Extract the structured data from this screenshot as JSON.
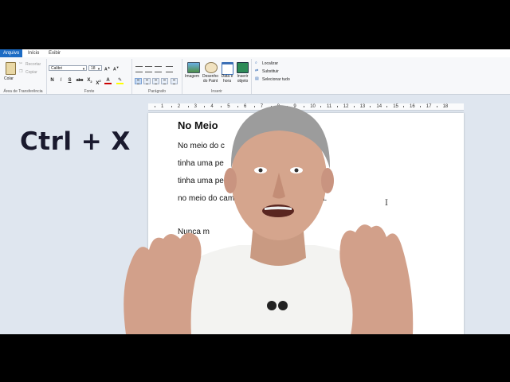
{
  "ribbon": {
    "tabs": [
      {
        "label": "Arquivo"
      },
      {
        "label": "Início"
      },
      {
        "label": "Exibir"
      }
    ],
    "clipboard": {
      "paste_label": "Colar",
      "cut_label": "Recortar",
      "copy_label": "Copiar",
      "group_label": "Área de Transferência"
    },
    "font": {
      "family": "Calibri",
      "size": "18",
      "bold": "N",
      "italic": "I",
      "underline": "S",
      "strike": "abc",
      "group_label": "Fonte"
    },
    "paragraph": {
      "group_label": "Parágrafo"
    },
    "insert": {
      "image_label": "Imagem",
      "paint_label": "Desenho do Paint",
      "datetime_label": "Data e hora",
      "object_label": "Inserir objeto",
      "group_label": "Inserir"
    },
    "editing": {
      "find_label": "Localizar",
      "replace_label": "Substituir",
      "select_all_label": "Selecionar tudo"
    }
  },
  "ruler": {
    "labels": [
      "1",
      "2",
      "3",
      "4",
      "5",
      "6",
      "7",
      "8",
      "9",
      "10",
      "11",
      "12",
      "13",
      "14",
      "15",
      "16",
      "17",
      "18"
    ]
  },
  "document": {
    "title": "No Meio",
    "lines": [
      "No meio do c",
      "tinha uma pe",
      "tinha uma pe",
      "no meio do cam",
      "",
      "Nunca m"
    ],
    "line_tail": "a."
  },
  "overlay": {
    "shortcut": "Ctrl + X"
  },
  "colors": {
    "file_tab": "#1c6bc4",
    "overlay_text": "#1a1a2e",
    "background": "#dfe6ef"
  }
}
